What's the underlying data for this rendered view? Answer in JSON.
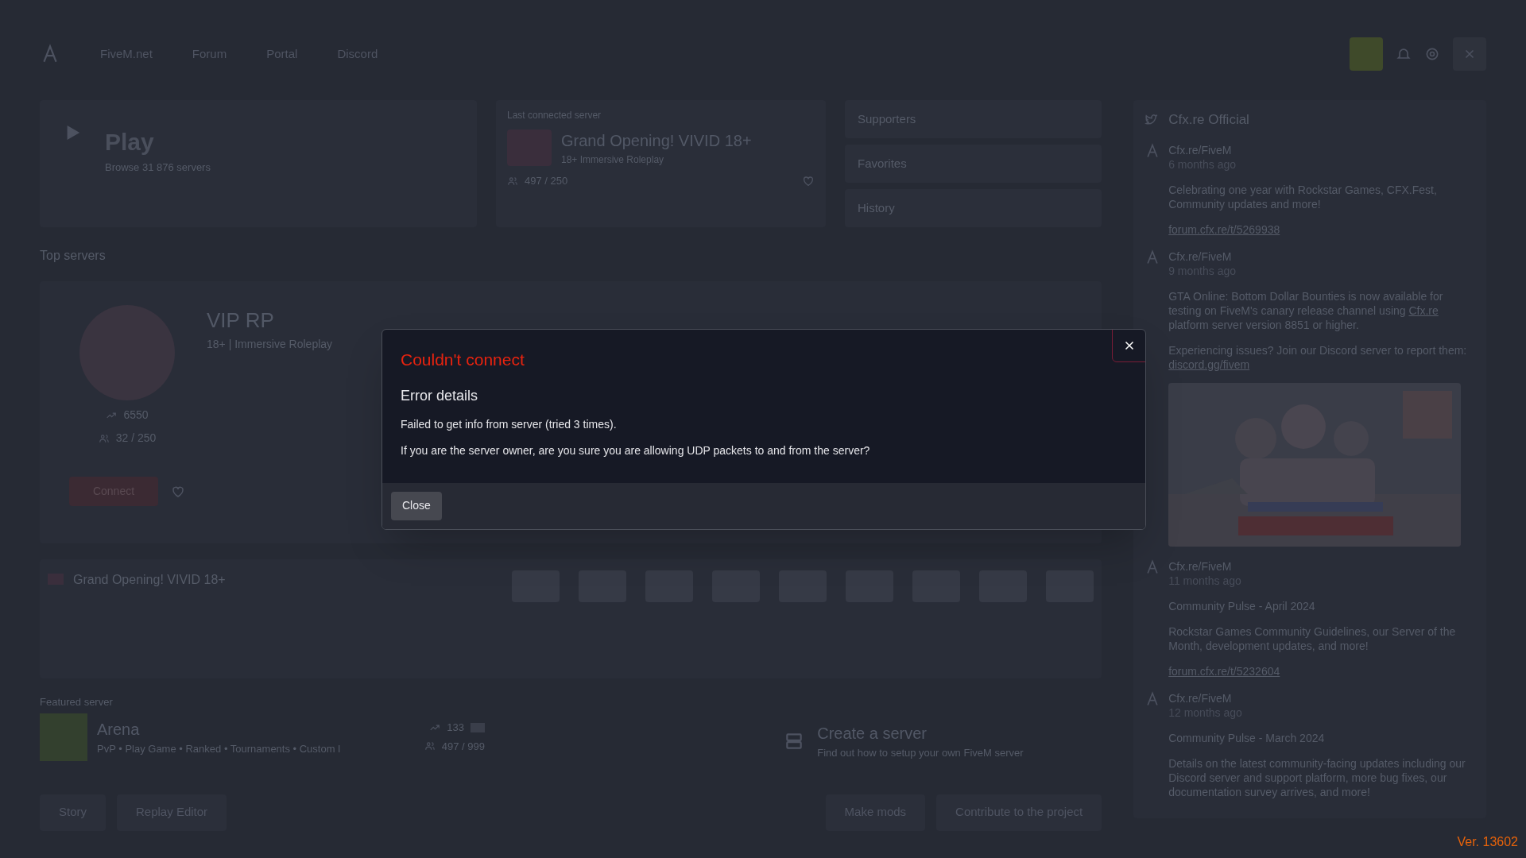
{
  "nav": {
    "items": [
      "FiveM.net",
      "Forum",
      "Portal",
      "Discord"
    ]
  },
  "play": {
    "title": "Play",
    "subtitle": "Browse 31 876 servers"
  },
  "last_server": {
    "label": "Last connected server",
    "name": "Grand Opening! VIVID 18+",
    "description": "18+ Immersive Roleplay",
    "players": "497 / 250"
  },
  "quick_links": [
    "Supporters",
    "Favorites",
    "History"
  ],
  "top_servers": {
    "title": "Top servers",
    "name": "VIP RP",
    "description": "18+ | Immersive Roleplay",
    "boosts": "6550",
    "players": "32 / 250",
    "connect": "Connect"
  },
  "promo": {
    "title": "Grand Opening! VIVID 18+"
  },
  "featured": {
    "label": "Featured server",
    "name": "Arena",
    "tags": "PvP • Play Game • Ranked • Tournaments • Custom l",
    "boosts": "133",
    "players": "497 / 999"
  },
  "create": {
    "title": "Create a server",
    "subtitle": "Find out how to setup your own FiveM server"
  },
  "bottom_buttons": {
    "left": [
      "Story",
      "Replay Editor"
    ],
    "right": [
      "Make mods",
      "Contribute to the project"
    ]
  },
  "feed": {
    "title": "Cfx.re Official",
    "posts": [
      {
        "author": "Cfx.re/FiveM",
        "time": "6 months ago",
        "blocks": [
          {
            "kind": "text",
            "parts": [
              {
                "text": "Celebrating one year with Rockstar Games, CFX.Fest, Community updates and more!",
                "link": false
              }
            ]
          },
          {
            "kind": "text",
            "parts": [
              {
                "text": "forum.cfx.re/t/5269938",
                "link": true
              }
            ]
          }
        ]
      },
      {
        "author": "Cfx.re/FiveM",
        "time": "9 months ago",
        "blocks": [
          {
            "kind": "text",
            "parts": [
              {
                "text": "GTA Online: Bottom Dollar Bounties is now available for testing on FiveM's canary release channel using ",
                "link": false
              },
              {
                "text": "Cfx.re",
                "link": true
              },
              {
                "text": " platform server version 8851 or higher.",
                "link": false
              }
            ]
          },
          {
            "kind": "text",
            "parts": [
              {
                "text": "Experiencing issues? Join our Discord server to report them: ",
                "link": false
              },
              {
                "text": "discord.gg/fivem",
                "link": true
              }
            ]
          },
          {
            "kind": "picture"
          }
        ]
      },
      {
        "author": "Cfx.re/FiveM",
        "time": "11 months ago",
        "blocks": [
          {
            "kind": "text",
            "parts": [
              {
                "text": "Community Pulse - April 2024",
                "link": false
              }
            ]
          },
          {
            "kind": "text",
            "parts": [
              {
                "text": "Rockstar Games Community Guidelines, our Server of the Month, development updates, and more!",
                "link": false
              }
            ]
          },
          {
            "kind": "text",
            "parts": [
              {
                "text": "forum.cfx.re/t/5232604",
                "link": true
              }
            ]
          }
        ]
      },
      {
        "author": "Cfx.re/FiveM",
        "time": "12 months ago",
        "blocks": [
          {
            "kind": "text",
            "parts": [
              {
                "text": "Community Pulse - March 2024",
                "link": false
              }
            ]
          },
          {
            "kind": "text",
            "parts": [
              {
                "text": "Details on the latest community-facing updates including our Discord server and support platform, more bug fixes, our documentation survey arrives, and more!",
                "link": false
              }
            ]
          }
        ]
      }
    ]
  },
  "dialog": {
    "title": "Couldn't connect",
    "heading": "Error details",
    "paragraphs": [
      "Failed to get info from server (tried 3 times).",
      "If you are the server owner, are you sure you are allowing UDP packets to and from the server?"
    ],
    "button": "Close"
  },
  "version": "Ver. 13602"
}
